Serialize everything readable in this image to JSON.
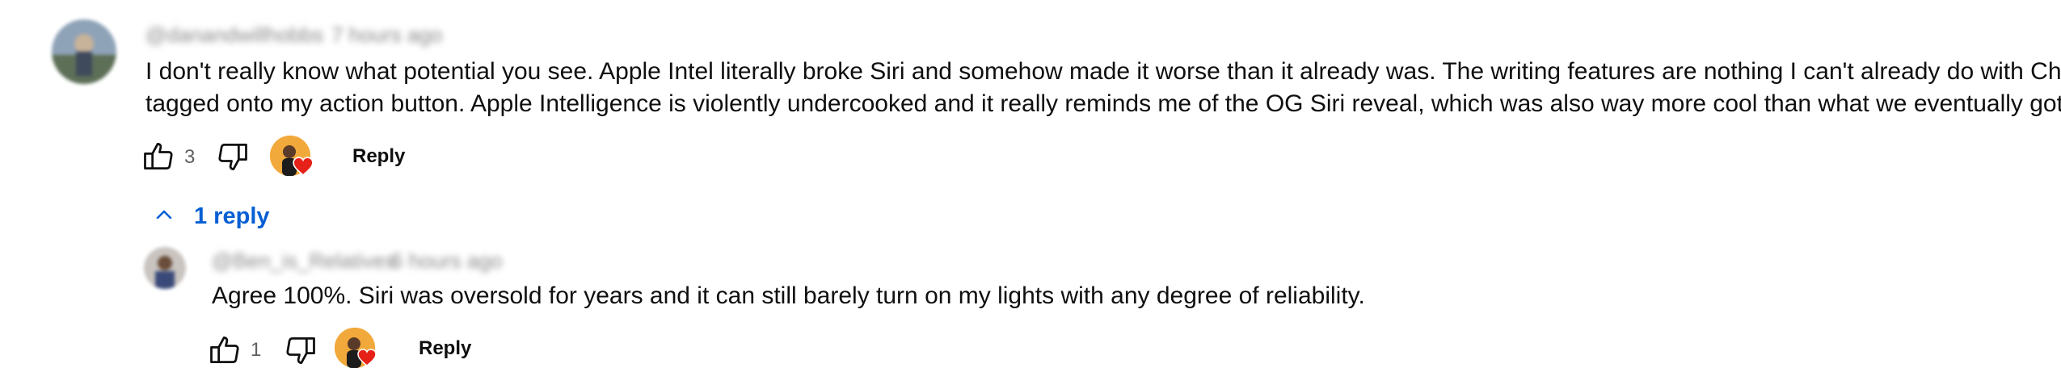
{
  "comment": {
    "author": "@danandwillhobbs",
    "timestamp": "7 hours ago",
    "text_line1": "I don't really know what potential you see. Apple Intel literally broke Siri and somehow made it worse than it already was. The writing features are nothing I can't already do with ChatGPT",
    "text_line2": "tagged onto my action button. Apple Intelligence is violently undercooked and it really reminds me of the OG Siri reveal, which was also way more cool than what we eventually got.",
    "like_count": "3",
    "reply_label": "Reply",
    "replies_toggle_label": "1 reply"
  },
  "reply": {
    "author": "@Ben_is_Relatives",
    "timestamp": "6 hours ago",
    "text": "Agree 100%. Siri was oversold for years and it can still barely turn on my lights with any degree of reliability.",
    "like_count": "1",
    "reply_label": "Reply"
  },
  "colors": {
    "link_blue": "#065fd4",
    "heart_red": "#e62117",
    "creator_avatar_bg": "#f2a93b"
  },
  "icons": [
    "like-icon",
    "dislike-icon",
    "creator-heart-icon",
    "chevron-up-icon"
  ]
}
